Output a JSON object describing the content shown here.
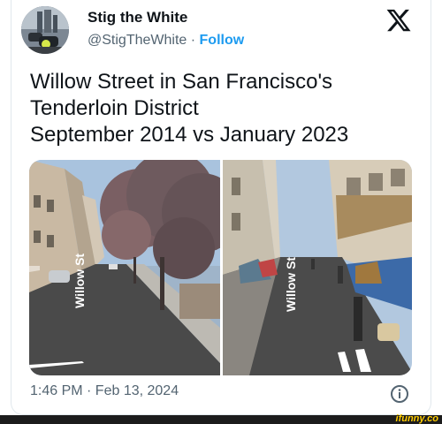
{
  "author": {
    "name": "Stig the White",
    "handle": "@StigTheWhite",
    "separator": "·",
    "follow_label": "Follow",
    "avatar_icon": "avatar-photo"
  },
  "tweet": {
    "text": "Willow Street in San Francisco's\nTenderloin District\nSeptember 2014 vs January 2023"
  },
  "media": {
    "left_street_label": "Willow St",
    "right_street_label": "Willow St"
  },
  "meta": {
    "timestamp": "1:46 PM · Feb 13, 2024"
  },
  "icons": {
    "brand": "x-logo-icon",
    "info": "info-icon"
  },
  "watermark": {
    "text": "ifunny.co"
  },
  "colors": {
    "accent": "#1d9bf0",
    "secondary_text": "#536471",
    "text": "#0f1419"
  }
}
